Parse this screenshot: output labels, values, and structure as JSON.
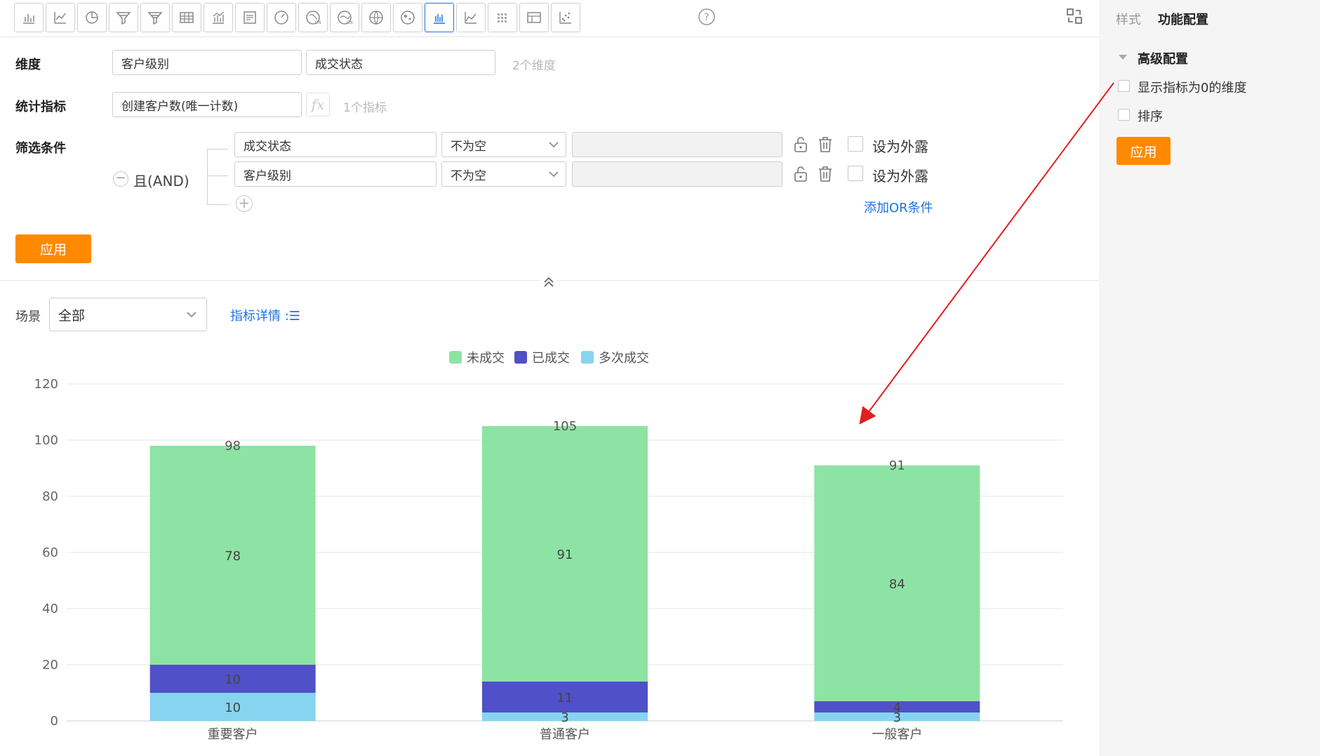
{
  "toolbar": {
    "buttons": [
      {
        "icon": "bar-chart-icon"
      },
      {
        "icon": "line-chart-icon"
      },
      {
        "icon": "pie-chart-icon"
      },
      {
        "icon": "funnel-icon"
      },
      {
        "icon": "funnel-compare-icon"
      },
      {
        "icon": "table-icon"
      },
      {
        "icon": "combo-chart-icon"
      },
      {
        "icon": "text-card-icon"
      },
      {
        "icon": "gauge-icon"
      },
      {
        "icon": "china-map-icon"
      },
      {
        "icon": "china-map-alt-icon"
      },
      {
        "icon": "world-map-icon"
      },
      {
        "icon": "bubble-map-icon"
      },
      {
        "icon": "stacked-bar-icon",
        "active": true
      },
      {
        "icon": "area-chart-icon"
      },
      {
        "icon": "heatmap-icon"
      },
      {
        "icon": "pivot-table-icon"
      },
      {
        "icon": "scatter-icon"
      }
    ],
    "help_icon": "help-circle-icon",
    "swap_icon": "swap-icon"
  },
  "config": {
    "dimension_label": "维度",
    "dimensions": [
      "客户级别",
      "成交状态"
    ],
    "dimension_count": "2个维度",
    "metric_label": "统计指标",
    "metric": "创建客户数(唯一计数)",
    "fx_label": "fx",
    "metric_count": "1个指标",
    "filter_label": "筛选条件",
    "logic_toggle": "−",
    "logic_label": "且(AND)",
    "filters": [
      {
        "field": "成交状态",
        "operator": "不为空",
        "value": "",
        "expose_label": "设为外露"
      },
      {
        "field": "客户级别",
        "operator": "不为空",
        "value": "",
        "expose_label": "设为外露"
      }
    ],
    "add_condition": "+",
    "add_or_link": "添加OR条件",
    "apply_button": "应用"
  },
  "scene": {
    "label": "场景",
    "selected": "全部",
    "metric_detail_link": "指标详情 :☰"
  },
  "chart_data": {
    "type": "bar",
    "stacked": true,
    "categories": [
      "重要客户",
      "普通客户",
      "一般客户"
    ],
    "series": [
      {
        "name": "多次成交",
        "values": [
          10,
          3,
          3
        ],
        "color": "#87d4f0"
      },
      {
        "name": "已成交",
        "values": [
          10,
          11,
          4
        ],
        "color": "#5050c8"
      },
      {
        "name": "未成交",
        "values": [
          78,
          91,
          84
        ],
        "color": "#8de3a4"
      }
    ],
    "totals": [
      98,
      105,
      91
    ],
    "legend_order": [
      "未成交",
      "已成交",
      "多次成交"
    ],
    "ylim": [
      0,
      120
    ],
    "yticks": [
      0,
      20,
      40,
      60,
      80,
      100,
      120
    ],
    "grid": true,
    "legend_position": "top-center",
    "title": "",
    "xlabel": "",
    "ylabel": ""
  },
  "side_panel": {
    "tabs": [
      "样式",
      "功能配置"
    ],
    "active_tab": "功能配置",
    "section_title": "高级配置",
    "options": [
      "显示指标为0的维度",
      "排序"
    ],
    "apply_button": "应用"
  },
  "annotation": {
    "arrow_color": "#e02020"
  }
}
